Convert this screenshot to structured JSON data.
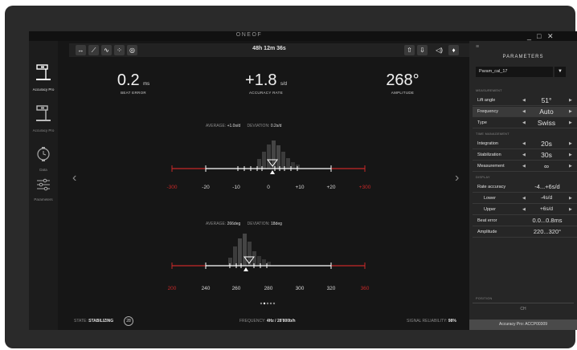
{
  "app": {
    "title": "ONEOF"
  },
  "window_controls": {
    "minimize": "_",
    "maximize": "□",
    "close": "✕"
  },
  "nav": {
    "items": [
      {
        "label": "Accuracy Pro",
        "icon": "microscope-icon",
        "active": true
      },
      {
        "label": "Accuracy Pro",
        "icon": "microscope-icon",
        "active": false
      },
      {
        "label": "Data",
        "icon": "clock-icon",
        "active": false
      },
      {
        "label": "Parameters",
        "icon": "sliders-icon",
        "active": false
      }
    ]
  },
  "toolbar": {
    "timer": "48h 12m 36s",
    "left_icons": [
      "expand-arrows-icon",
      "trend-icon",
      "wave-icon",
      "scatter-icon",
      "target-icon"
    ],
    "right_icons": [
      "upload-icon",
      "download-icon",
      "volume-icon",
      "microphone-icon"
    ]
  },
  "metrics": {
    "beat_error": {
      "value": "0.2",
      "unit": "ms",
      "label": "BEAT ERROR"
    },
    "accuracy_rate": {
      "value": "+1.8",
      "unit": "s/d",
      "label": "ACCURACY RATE"
    },
    "amplitude": {
      "value": "268°",
      "unit": "",
      "label": "AMPLITUDE"
    }
  },
  "histograms": {
    "rate": {
      "average_label": "AVERAGE:",
      "average_value": "+1.0s/d",
      "deviation_label": "DEVIATION:",
      "deviation_value": "0.2s/d",
      "ticks": [
        {
          "label": "-300",
          "value": -300,
          "red": true
        },
        {
          "label": "-20",
          "value": -20,
          "red": false
        },
        {
          "label": "-10",
          "value": -10,
          "red": false
        },
        {
          "label": "0",
          "value": 0,
          "red": false
        },
        {
          "label": "+10",
          "value": 10,
          "red": false
        },
        {
          "label": "+20",
          "value": 20,
          "red": false
        },
        {
          "label": "+300",
          "value": 300,
          "red": true
        }
      ],
      "marker": 1.8
    },
    "amplitude": {
      "average_label": "AVERAGE:",
      "average_value": "266deg",
      "deviation_label": "DEVIATION:",
      "deviation_value": "18deg",
      "ticks": [
        {
          "label": "200",
          "value": 200,
          "red": true
        },
        {
          "label": "240",
          "value": 240,
          "red": false
        },
        {
          "label": "260",
          "value": 260,
          "red": false
        },
        {
          "label": "280",
          "value": 280,
          "red": false
        },
        {
          "label": "300",
          "value": 300,
          "red": false
        },
        {
          "label": "320",
          "value": 320,
          "red": false
        },
        {
          "label": "360",
          "value": 360,
          "red": true
        }
      ],
      "marker": 268
    }
  },
  "pager": {
    "count": 5,
    "active": 1
  },
  "status": {
    "state_label": "STATE:",
    "state_value": "STABILIZING",
    "state_counter": "28",
    "frequency_label": "FREQUENCY:",
    "frequency_value": "4Hz / 28'800b/h",
    "signal_label": "SIGNAL RELIABILITY:",
    "signal_value": "98%"
  },
  "panel": {
    "title": "PARAMETERS",
    "preset": "Param_cal_17",
    "sections": {
      "measurement": "MEASUREMENT",
      "time_management": "TIME MANAGEMENT",
      "display": "DISPLAY",
      "position": "POSITION"
    },
    "measurement": [
      {
        "label": "Lift angle",
        "value": "51°"
      },
      {
        "label": "Frequency",
        "value": "Auto"
      },
      {
        "label": "Type",
        "value": "Swiss"
      }
    ],
    "time_management": [
      {
        "label": "Integration",
        "value": "20s"
      },
      {
        "label": "Stabilization",
        "value": "30s"
      },
      {
        "label": "Measurement",
        "value": "∞"
      }
    ],
    "display": [
      {
        "label": "Rate accuracy",
        "value": "-4...+6s/d"
      },
      {
        "label": "Lower",
        "value": "-4s/d"
      },
      {
        "label": "Upper",
        "value": "+6s/d"
      },
      {
        "label": "Beat error",
        "value": "0.0...0.8ms"
      },
      {
        "label": "Amplitude",
        "value": "220...320°"
      }
    ],
    "position_value": "CH",
    "device": "Accuracy Pro: ACCP00309"
  }
}
